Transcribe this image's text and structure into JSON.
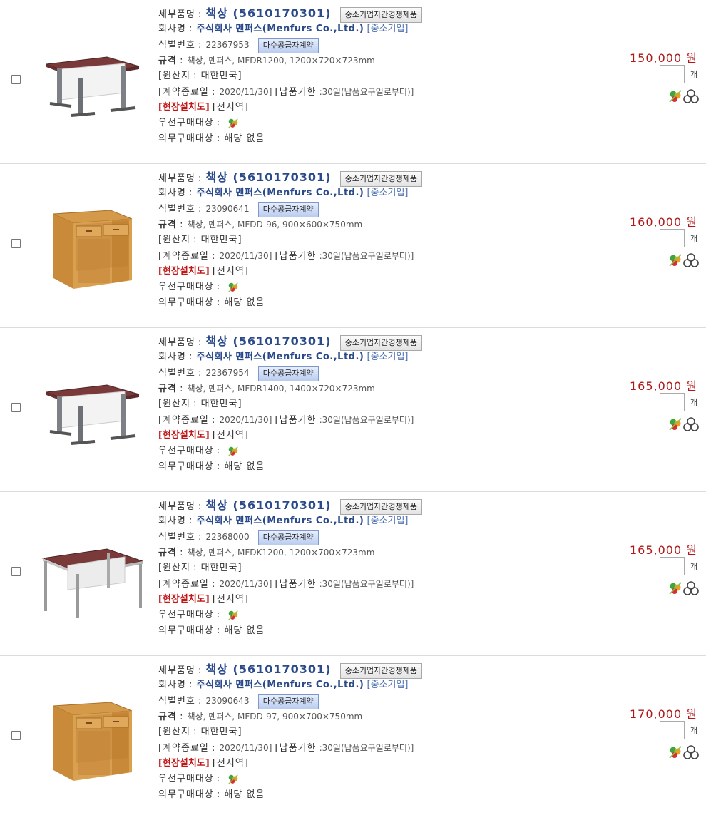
{
  "labels": {
    "detail_name": "세부품명",
    "company": "회사명",
    "id_number": "식별번호",
    "spec": "규격",
    "origin_label": "[원산지",
    "contract_end_label": "[계약종료일",
    "delivery_label": "[납품기한",
    "onsite": "[현장설치도]",
    "region": "[전지역]",
    "priority_purchase": "우선구매대상",
    "mandatory_purchase": "의무구매대상",
    "unit": "개",
    "price_suffix": "원",
    "sme_badge": "중소기업자간경쟁제품",
    "multi_contract_badge": "다수공급자계약",
    "sme_tag": "[중소기업]"
  },
  "items": [
    {
      "product": "책상 (5610170301)",
      "company_name": "주식회사 멘퍼스(Menfurs Co.,Ltd.)",
      "id": "22367953",
      "spec": "책상, 멘퍼스, MFDR1200, 1200×720×723mm",
      "origin": "대한민국]",
      "contract_end": "2020/11/30]",
      "delivery": ":30일(납품요구일로부터)]",
      "mandatory": "해당 없음",
      "price": "150,000",
      "image": "desk-metal-leg-icon"
    },
    {
      "product": "책상 (5610170301)",
      "company_name": "주식회사 멘퍼스(Menfurs Co.,Ltd.)",
      "id": "23090641",
      "spec": "책상, 멘퍼스, MFDD-96, 900×600×750mm",
      "origin": "대한민국]",
      "contract_end": "2020/11/30]",
      "delivery": ":30일(납품요구일로부터)]",
      "mandatory": "해당 없음",
      "price": "160,000",
      "image": "desk-wood-drawer-icon"
    },
    {
      "product": "책상 (5610170301)",
      "company_name": "주식회사 멘퍼스(Menfurs Co.,Ltd.)",
      "id": "22367954",
      "spec": "책상, 멘퍼스, MFDR1400, 1400×720×723mm",
      "origin": "대한민국]",
      "contract_end": "2020/11/30]",
      "delivery": ":30일(납품요구일로부터)]",
      "mandatory": "해당 없음",
      "price": "165,000",
      "image": "desk-metal-leg-icon"
    },
    {
      "product": "책상 (5610170301)",
      "company_name": "주식회사 멘퍼스(Menfurs Co.,Ltd.)",
      "id": "22368000",
      "spec": "책상, 멘퍼스, MFDK1200, 1200×700×723mm",
      "origin": "대한민국]",
      "contract_end": "2020/11/30]",
      "delivery": ":30일(납품요구일로부터)]",
      "mandatory": "해당 없음",
      "price": "165,000",
      "image": "desk-frame-leg-icon"
    },
    {
      "product": "책상 (5610170301)",
      "company_name": "주식회사 멘퍼스(Menfurs Co.,Ltd.)",
      "id": "23090643",
      "spec": "책상, 멘퍼스, MFDD-97, 900×700×750mm",
      "origin": "대한민국]",
      "contract_end": "2020/11/30]",
      "delivery": ":30일(납품요구일로부터)]",
      "mandatory": "해당 없음",
      "price": "170,000",
      "image": "desk-wood-drawer-icon"
    }
  ],
  "colors": {
    "price": "#b01818",
    "link_blue": "#2a4a8a",
    "red_label": "#c01818"
  }
}
